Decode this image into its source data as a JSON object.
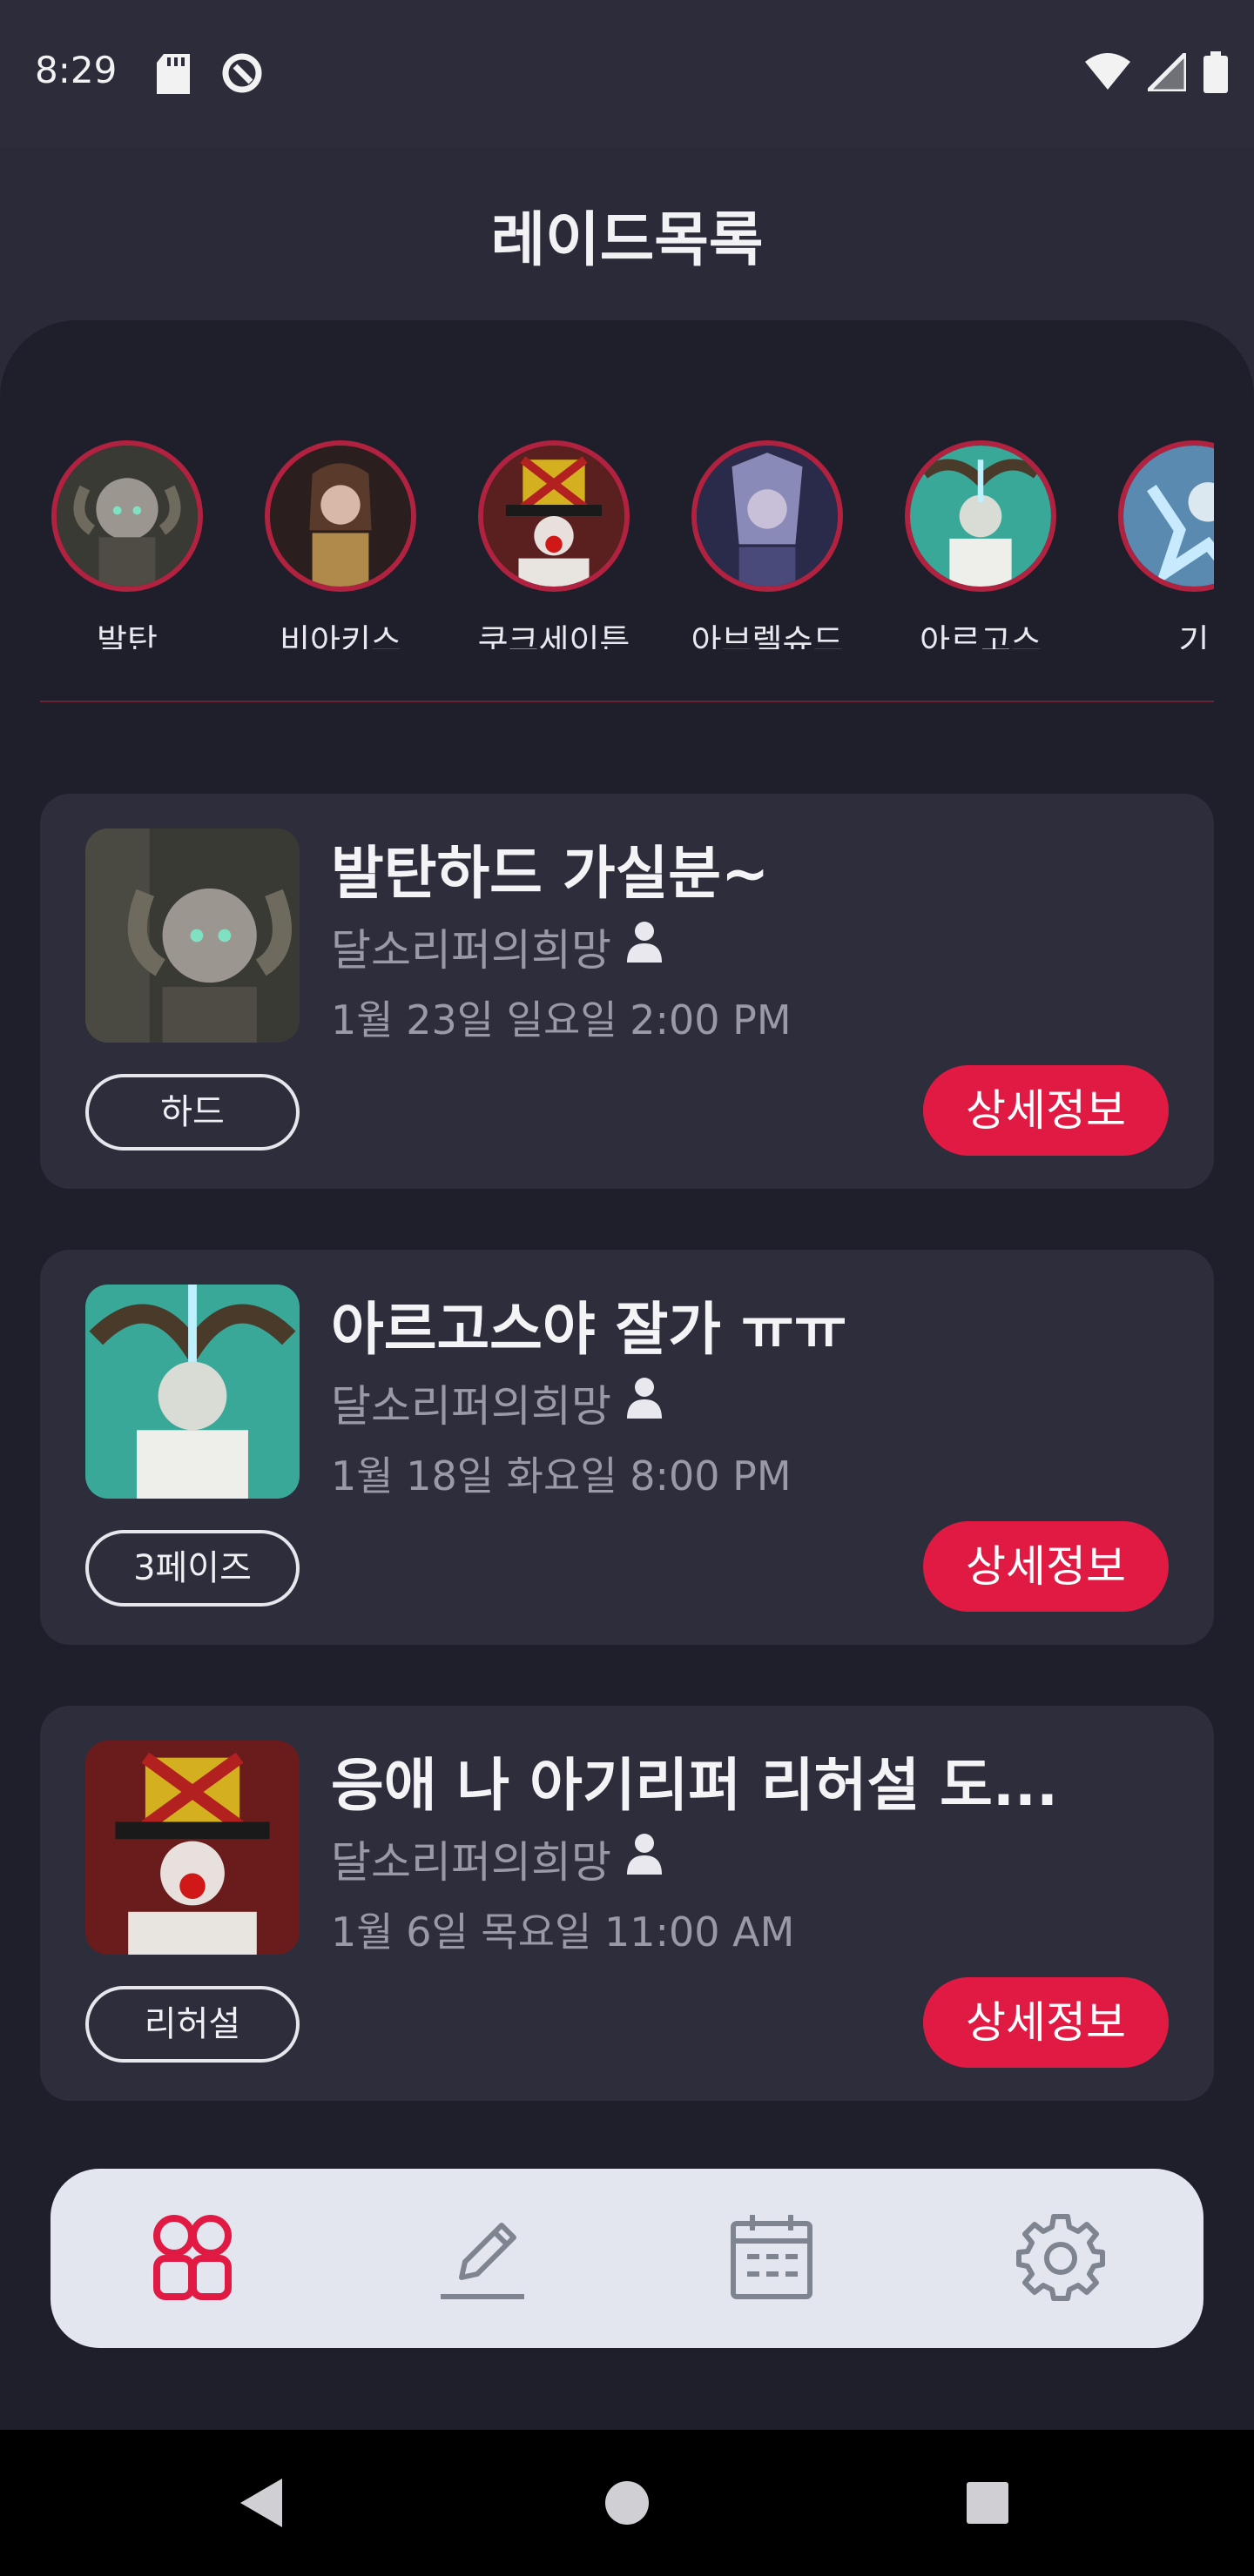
{
  "status_bar": {
    "time": "8:29",
    "icons": [
      "sd-card-icon",
      "data-saver-icon",
      "wifi-icon",
      "signal-icon",
      "battery-icon"
    ]
  },
  "header": {
    "title": "레이드목록"
  },
  "bosses": [
    {
      "name": "발탄"
    },
    {
      "name": "비아키스"
    },
    {
      "name": "쿠크세이튼"
    },
    {
      "name": "아브렐슈드"
    },
    {
      "name": "아르고스"
    },
    {
      "name": "기"
    }
  ],
  "raids": [
    {
      "title": "발탄하드 가실분~",
      "leader": "달소리퍼의희망",
      "date": "1월 23일 일요일 2:00 PM",
      "tag": "하드",
      "detail_label": "상세정보"
    },
    {
      "title": "아르고스야 잘가 ㅠㅠ",
      "leader": "달소리퍼의희망",
      "date": "1월 18일 화요일 8:00 PM",
      "tag": "3페이즈",
      "detail_label": "상세정보"
    },
    {
      "title": "응애 나 아기리퍼 리허설 도...",
      "leader": "달소리퍼의희망",
      "date": "1월 6일 목요일 11:00 AM",
      "tag": "리허설",
      "detail_label": "상세정보"
    }
  ],
  "bottom_nav": {
    "items": [
      {
        "icon": "group-icon",
        "active": true
      },
      {
        "icon": "pencil-icon",
        "active": false
      },
      {
        "icon": "calendar-icon",
        "active": false
      },
      {
        "icon": "gear-icon",
        "active": false
      }
    ]
  },
  "colors": {
    "accent": "#e11a43",
    "panel": "#1f1f2b",
    "card": "#2d2d3b",
    "nav_bg": "#e4e6ef",
    "nav_icon": "#7f8590"
  }
}
